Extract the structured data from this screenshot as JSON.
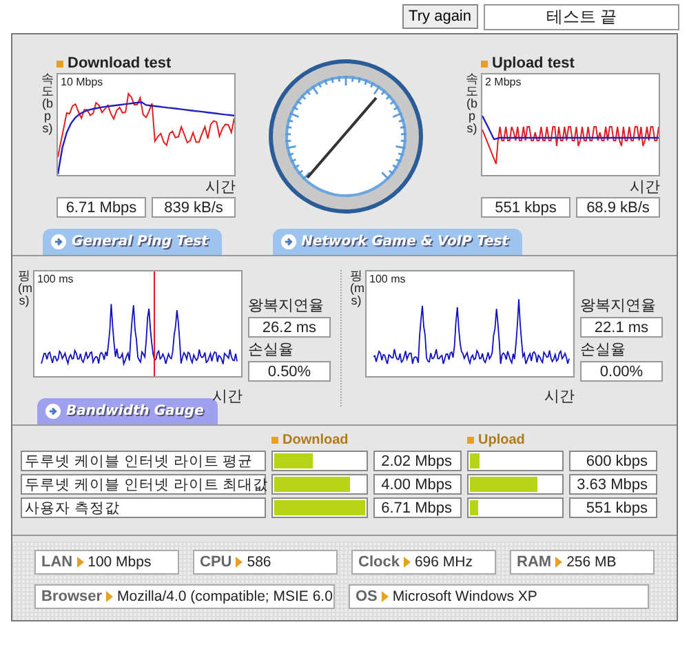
{
  "header": {
    "retry_button": "Try again",
    "status": "테스트 끝"
  },
  "speed_tests": [
    {
      "kind": "download",
      "title": "Download test",
      "y_axis": "속도(bps)",
      "scale": "10 Mbps",
      "x_axis": "시간",
      "rate": "6.71 Mbps",
      "throughput": "839 kB/s"
    },
    {
      "kind": "upload",
      "title": "Upload test",
      "y_axis": "속도(bps)",
      "scale": "2 Mbps",
      "x_axis": "시간",
      "rate": "551 kbps",
      "throughput": "68.9 kB/s"
    }
  ],
  "ping_tests": [
    {
      "tab": "General Ping Test",
      "y_axis": "핑(ms)",
      "scale": "100 ms",
      "x_axis": "시간",
      "latency_label": "왕복지연율",
      "latency": "26.2 ms",
      "loss_label": "손실율",
      "loss": "0.50%"
    },
    {
      "tab": "Network Game & VoIP Test",
      "y_axis": "핑(ms)",
      "scale": "100 ms",
      "x_axis": "시간",
      "latency_label": "왕복지연율",
      "latency": "22.1 ms",
      "loss_label": "손실율",
      "loss": "0.00%"
    }
  ],
  "bandwidth": {
    "tab": "Bandwidth Gauge",
    "columns": [
      "Download",
      "Upload"
    ],
    "rows": [
      {
        "name": "두루넷 케이블 인터넷 라이트 평균",
        "download": {
          "level": 0.42,
          "value": "2.02 Mbps"
        },
        "upload": {
          "level": 0.1,
          "value": "600 kbps"
        }
      },
      {
        "name": "두루넷 케이블 인터넷 라이트 최대값",
        "download": {
          "level": 0.83,
          "value": "4.00 Mbps"
        },
        "upload": {
          "level": 0.74,
          "value": "3.63 Mbps"
        }
      },
      {
        "name": "사용자 측정값",
        "download": {
          "level": 1.0,
          "value": "6.71 Mbps"
        },
        "upload": {
          "level": 0.09,
          "value": "551 kbps"
        }
      }
    ]
  },
  "system": [
    [
      {
        "label": "LAN",
        "value": "100 Mbps"
      },
      {
        "label": "CPU",
        "value": "586"
      },
      {
        "label": "Clock",
        "value": "696 MHz"
      },
      {
        "label": "RAM",
        "value": "256 MB"
      }
    ],
    [
      {
        "label": "Browser",
        "value": "Mozilla/4.0 (compatible; MSIE 6.0"
      },
      {
        "label": "OS",
        "value": "Microsoft Windows XP"
      }
    ]
  ]
}
